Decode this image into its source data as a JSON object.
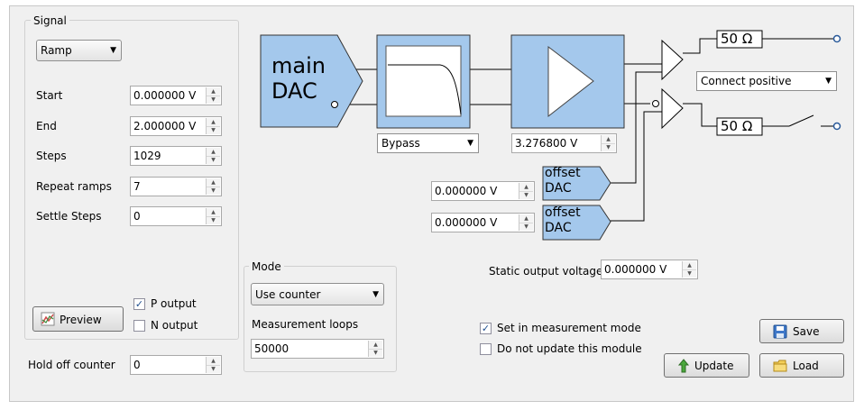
{
  "signal": {
    "group_title": "Signal",
    "waveform": "Ramp",
    "fields": [
      {
        "label": "Start",
        "value": "0.000000 V"
      },
      {
        "label": "End",
        "value": "2.000000 V"
      },
      {
        "label": "Steps",
        "value": "1029"
      },
      {
        "label": "Repeat ramps",
        "value": "7"
      },
      {
        "label": "Settle Steps",
        "value": "0"
      }
    ],
    "preview_label": "Preview",
    "p_output": {
      "label": "P output",
      "checked": true
    },
    "n_output": {
      "label": "N output",
      "checked": false
    }
  },
  "hold_off": {
    "label": "Hold off counter",
    "value": "0"
  },
  "mode": {
    "group_title": "Mode",
    "selected": "Use counter",
    "loops_label": "Measurement loops",
    "loops_value": "50000"
  },
  "diagram": {
    "main_dac_line1": "main",
    "main_dac_line2": "DAC",
    "filter_select": "Bypass",
    "gain_value": "3.276800 V",
    "resistor_top": "50 Ω",
    "resistor_bottom": "50 Ω",
    "connect_select": "Connect positive",
    "offset_dac_1": {
      "value": "0.000000 V",
      "line1": "offset",
      "line2": "DAC"
    },
    "offset_dac_2": {
      "value": "0.000000 V",
      "line1": "offset",
      "line2": "DAC"
    },
    "block_color": "#a4c8ec"
  },
  "static_output": {
    "label": "Static output voltage",
    "value": "0.000000 V"
  },
  "options": {
    "set_in_measurement": {
      "label": "Set in measurement mode",
      "checked": true
    },
    "do_not_update": {
      "label": "Do not update this module",
      "checked": false
    }
  },
  "buttons": {
    "save": "Save",
    "update": "Update",
    "load": "Load"
  }
}
